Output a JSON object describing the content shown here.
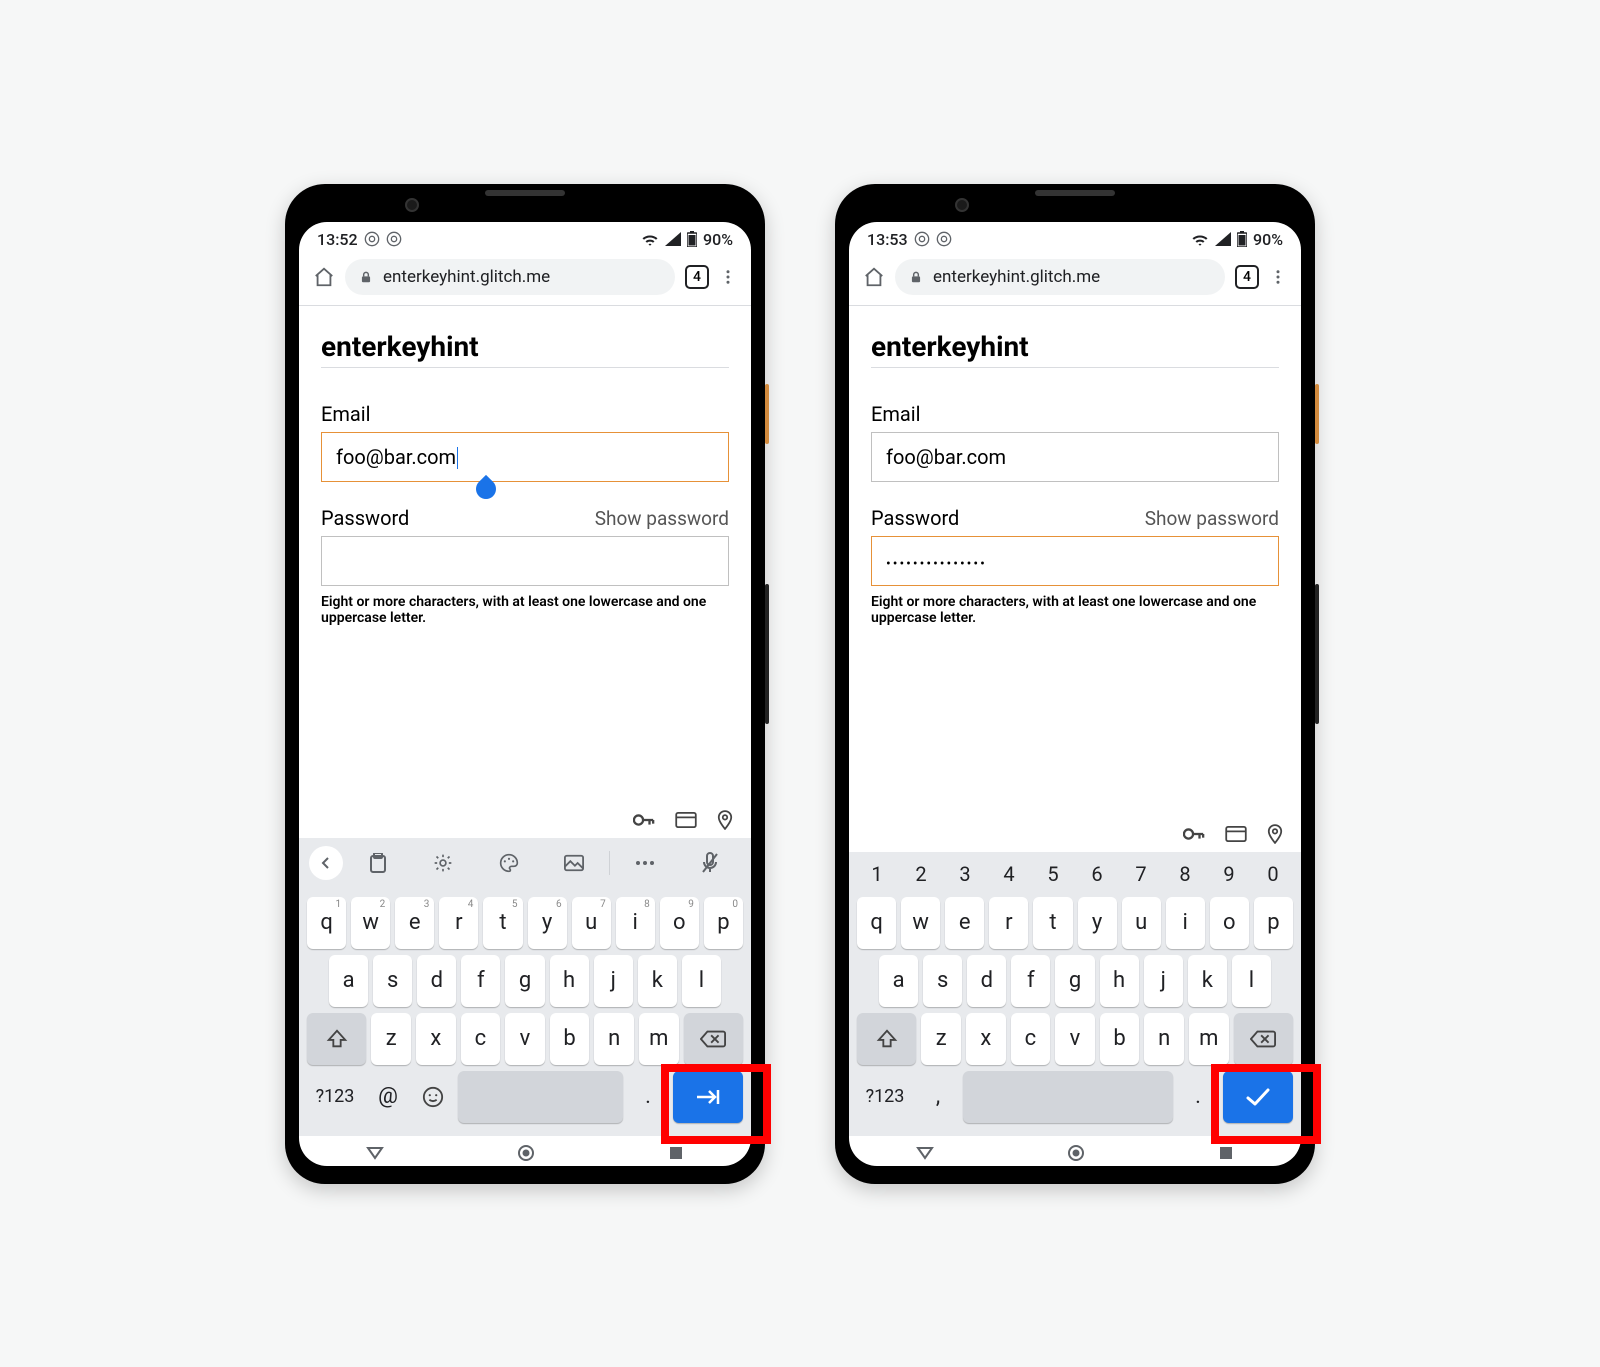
{
  "phones": [
    {
      "status": {
        "time": "13:52",
        "battery": "90%"
      },
      "url": "enterkeyhint.glitch.me",
      "tab_count": "4",
      "page": {
        "title": "enterkeyhint",
        "email_label": "Email",
        "email_value": "foo@bar.com",
        "email_focused": true,
        "password_label": "Password",
        "show_password": "Show password",
        "password_value": "",
        "password_focused": false,
        "hint": "Eight or more characters, with at least one lowercase and one uppercase letter."
      },
      "keyboard": {
        "has_number_row": false,
        "has_toolbar": true,
        "row1_sup": true,
        "bottom_left2": "@",
        "enter_icon": "next"
      }
    },
    {
      "status": {
        "time": "13:53",
        "battery": "90%"
      },
      "url": "enterkeyhint.glitch.me",
      "tab_count": "4",
      "page": {
        "title": "enterkeyhint",
        "email_label": "Email",
        "email_value": "foo@bar.com",
        "email_focused": false,
        "password_label": "Password",
        "show_password": "Show password",
        "password_value": "•••••••••••••••",
        "password_focused": true,
        "hint": "Eight or more characters, with at least one lowercase and one uppercase letter."
      },
      "keyboard": {
        "has_number_row": true,
        "has_toolbar": false,
        "row1_sup": false,
        "bottom_left2": ",",
        "enter_icon": "done"
      }
    }
  ],
  "kbd_rows": {
    "nums": [
      "1",
      "2",
      "3",
      "4",
      "5",
      "6",
      "7",
      "8",
      "9",
      "0"
    ],
    "r1": [
      "q",
      "w",
      "e",
      "r",
      "t",
      "y",
      "u",
      "i",
      "o",
      "p"
    ],
    "r1_sup": [
      "1",
      "2",
      "3",
      "4",
      "5",
      "6",
      "7",
      "8",
      "9",
      "0"
    ],
    "r2": [
      "a",
      "s",
      "d",
      "f",
      "g",
      "h",
      "j",
      "k",
      "l"
    ],
    "r3": [
      "z",
      "x",
      "c",
      "v",
      "b",
      "n",
      "m"
    ],
    "sym": "?123",
    "period": "."
  }
}
